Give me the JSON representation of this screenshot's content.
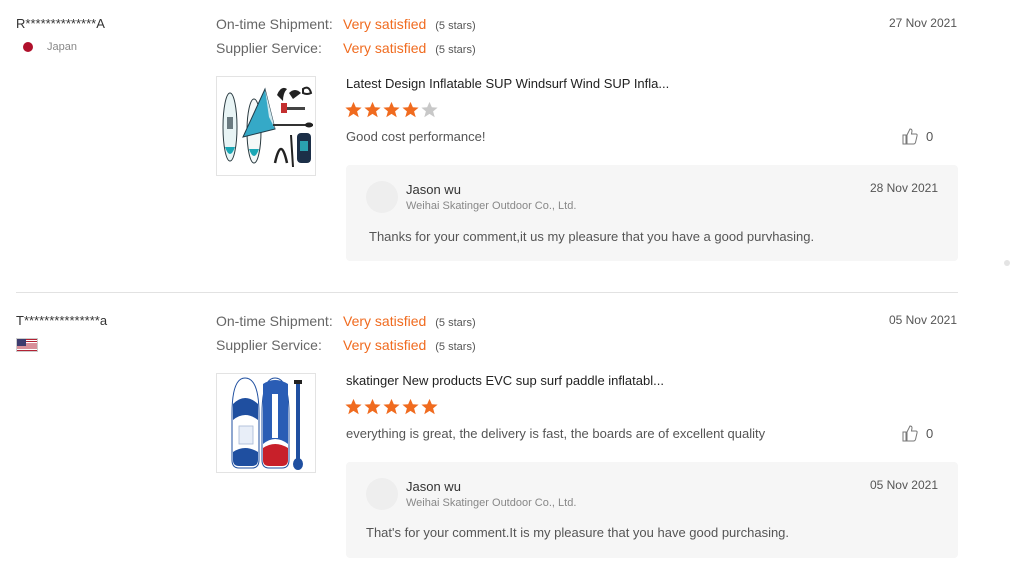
{
  "reviews": [
    {
      "buyer": "R**************A",
      "country": "Japan",
      "date": "27 Nov 2021",
      "ratings": [
        {
          "label": "On-time Shipment:",
          "value": "Very satisfied",
          "stars_text": "(5 stars)"
        },
        {
          "label": "Supplier Service:",
          "value": "Very satisfied",
          "stars_text": "(5 stars)"
        }
      ],
      "product_title": "Latest Design Inflatable SUP Windsurf Wind SUP Infla...",
      "product_rating": 4,
      "comment": "Good cost performance!",
      "likes": "0",
      "reply": {
        "name": "Jason wu",
        "company": "Weihai Skatinger Outdoor Co., Ltd.",
        "date": "28 Nov 2021",
        "text": "Thanks for your comment,it us my pleasure that you have a good purvhasing."
      }
    },
    {
      "buyer": "T***************a",
      "country": "",
      "date": "05 Nov 2021",
      "ratings": [
        {
          "label": "On-time Shipment:",
          "value": "Very satisfied",
          "stars_text": "(5 stars)"
        },
        {
          "label": "Supplier Service:",
          "value": "Very satisfied",
          "stars_text": "(5 stars)"
        }
      ],
      "product_title": "skatinger New products EVC sup surf paddle inflatabl...",
      "product_rating": 5,
      "comment": "everything is great, the delivery is fast, the boards are of excellent quality",
      "likes": "0",
      "reply": {
        "name": "Jason wu",
        "company": "Weihai Skatinger Outdoor Co., Ltd.",
        "date": "05 Nov 2021",
        "text": "That's for your comment.It is my pleasure that you have good purchasing."
      }
    }
  ],
  "colors": {
    "accent": "#f06b1f",
    "star_empty": "#c8c8c8",
    "reply_bg": "#f6f6f6"
  },
  "icons": [
    "thumbs-up-icon",
    "star-icon",
    "japan-flag-icon",
    "us-flag-icon"
  ]
}
